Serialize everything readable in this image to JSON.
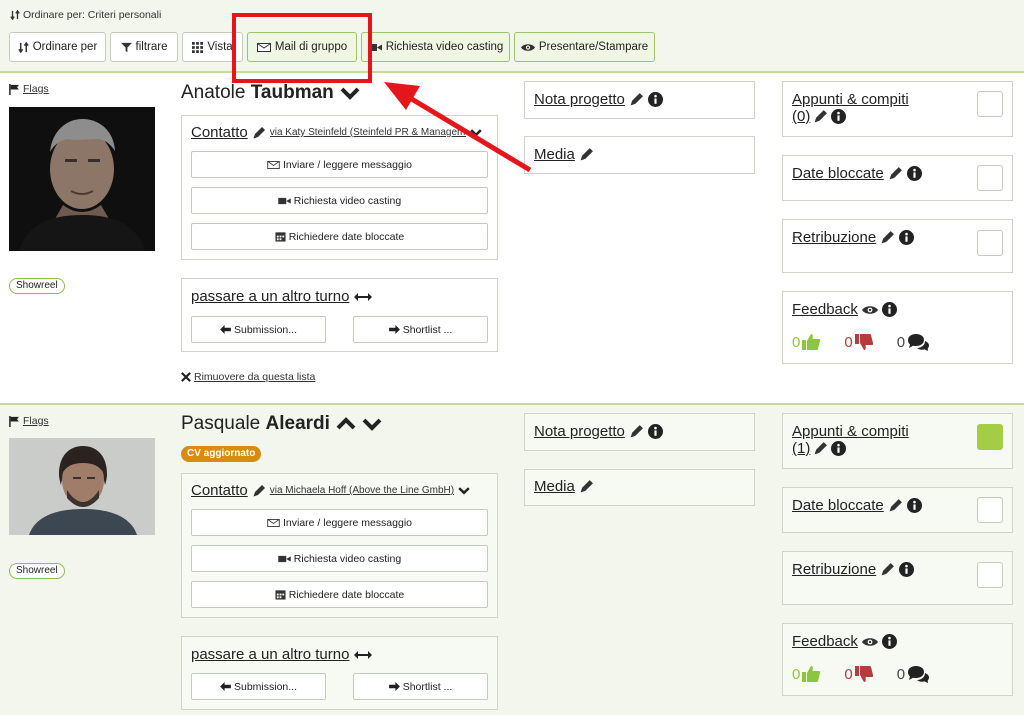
{
  "toolbar": {
    "sort_label": "Ordinare per: Criteri personali",
    "buttons": {
      "sort": "Ordinare per",
      "filter": "filtrare",
      "view": "Vista",
      "group_mail": "Mail di gruppo",
      "video_casting": "Richiesta video casting",
      "present_print": "Presentare/Stampare"
    }
  },
  "common": {
    "flags": "Flags",
    "showreel": "Showreel",
    "contact": "Contatto",
    "send_message": "Inviare / leggere messaggio",
    "video_request": "Richiesta video casting",
    "blocked_dates_request": "Richiedere date bloccate",
    "move_turn": "passare a un altro turno",
    "submission": "Submission...",
    "shortlist": "Shortlist ...",
    "remove": "Rimuovere da questa lista",
    "project_note": "Nota progetto",
    "media": "Media",
    "blocked_dates": "Date bloccate",
    "fee": "Retribuzione",
    "feedback": "Feedback",
    "cv_updated": "CV aggiornato"
  },
  "actors": [
    {
      "first_name": "Anatole",
      "last_name": "Taubman",
      "agency": "via Katy Steinfeld (Steinfeld PR & Management)",
      "notes_label": "Appunti & compiti",
      "notes_count": "(0)",
      "notes_checked": false,
      "feedback": {
        "up": "0",
        "down": "0",
        "comments": "0"
      }
    },
    {
      "first_name": "Pasquale",
      "last_name": "Aleardi",
      "agency": "via Michaela Hoff (Above the Line GmbH)",
      "notes_label": "Appunti & compiti",
      "notes_count": "(1)",
      "notes_checked": true,
      "feedback": {
        "up": "0",
        "down": "0",
        "comments": "0"
      }
    }
  ],
  "colors": {
    "page_bg": "#f3f6ec",
    "accent_green": "#a3cd45",
    "thumb_up": "#8cc63f",
    "thumb_down": "#b43c3c",
    "badge_orange": "#d98b0c",
    "highlight_red": "#e5161b"
  }
}
